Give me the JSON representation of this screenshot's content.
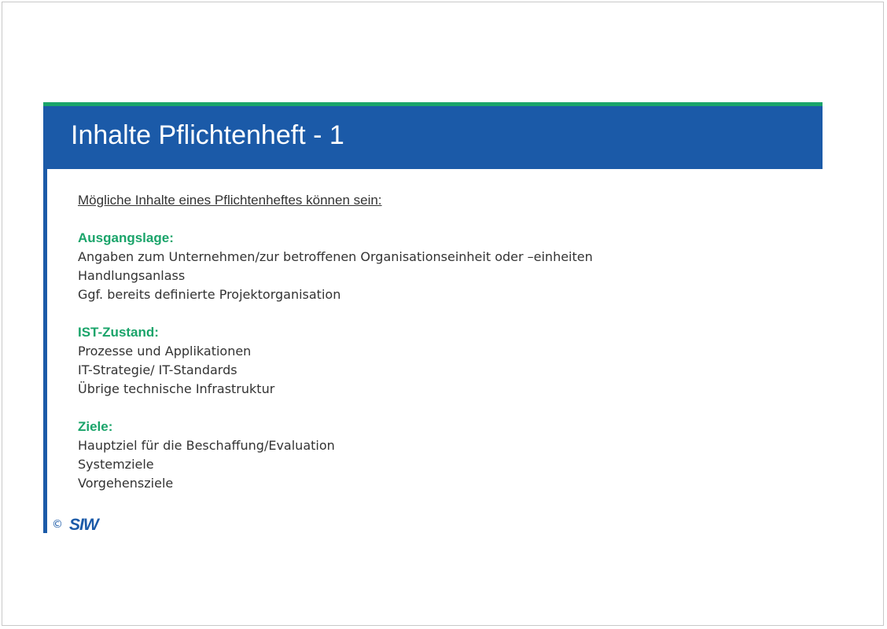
{
  "slide": {
    "title": "Inhalte Pflichtenheft - 1",
    "intro": "Mögliche Inhalte eines Pflichtenheftes können sein:"
  },
  "sections": [
    {
      "heading": "Ausgangslage:",
      "lines": [
        "Angaben zum Unternehmen/zur betroffenen Organisationseinheit oder –einheiten",
        "Handlungsanlass",
        "Ggf. bereits definierte Projektorganisation"
      ]
    },
    {
      "heading": "IST-Zustand:",
      "lines": [
        "Prozesse und Applikationen",
        "IT-Strategie/ IT-Standards",
        "Übrige technische Infrastruktur"
      ]
    },
    {
      "heading": "Ziele:",
      "lines": [
        "Hauptziel für die Beschaffung/Evaluation",
        "Systemziele",
        "Vorgehensziele"
      ]
    }
  ],
  "footer": {
    "copyright": "©",
    "logo_text": "SIW"
  },
  "colors": {
    "header_blue": "#1b5aa8",
    "accent_green": "#1aa46a",
    "body_text": "#333333"
  }
}
